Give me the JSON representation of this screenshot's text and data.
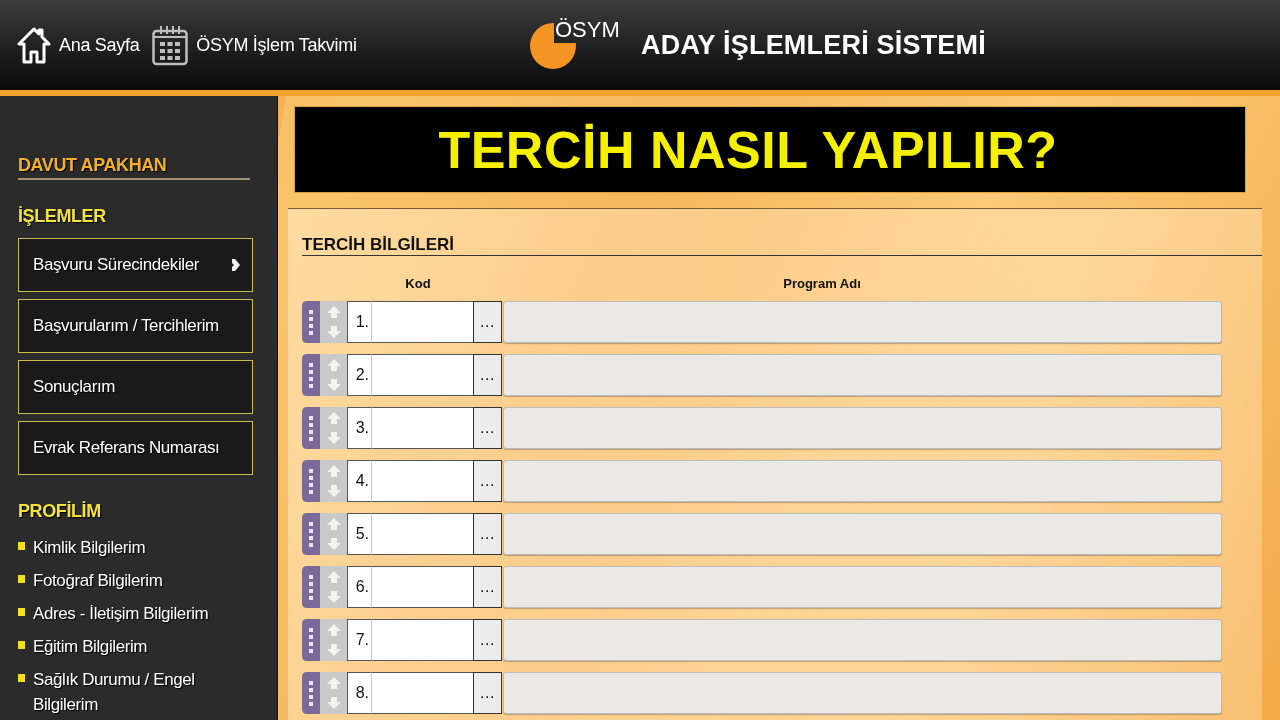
{
  "header": {
    "nav": [
      {
        "kind": "home",
        "label": "Ana Sayfa"
      },
      {
        "kind": "calendar",
        "label": "ÖSYM İşlem Takvimi"
      }
    ],
    "logo_text": "ÖSYM",
    "title": "ADAY İŞLEMLERİ SİSTEMİ"
  },
  "sidebar": {
    "user_name": "DAVUT APAKHAN",
    "sections": [
      {
        "kind": "buttons",
        "heading": "İŞLEMLER",
        "items": [
          {
            "label": "Başvuru Sürecindekiler",
            "has_submenu": true
          },
          {
            "label": "Başvurularım / Tercihlerim",
            "has_submenu": false
          },
          {
            "label": "Sonuçlarım",
            "has_submenu": false
          },
          {
            "label": "Evrak Referans Numarası",
            "has_submenu": false
          }
        ]
      },
      {
        "kind": "links",
        "heading": "PROFİLİM",
        "items": [
          {
            "label": "Kimlik Bilgilerim"
          },
          {
            "label": "Fotoğraf Bilgilerim"
          },
          {
            "label": "Adres - İletişim Bilgilerim"
          },
          {
            "label": "Eğitim Bilgilerim"
          },
          {
            "label": "Sağlık Durumu / Engel Bilgilerim"
          }
        ]
      }
    ]
  },
  "banner": {
    "title": "TERCİH NASIL YAPILIR?"
  },
  "preferences": {
    "title": "TERCİH BİLGİLERİ",
    "columns": [
      "Kod",
      "Program Adı"
    ],
    "rows": [
      {
        "number": "1.",
        "lookup_label": "..."
      },
      {
        "number": "2.",
        "lookup_label": "..."
      },
      {
        "number": "3.",
        "lookup_label": "..."
      },
      {
        "number": "4.",
        "lookup_label": "..."
      },
      {
        "number": "5.",
        "lookup_label": "..."
      },
      {
        "number": "6.",
        "lookup_label": "..."
      },
      {
        "number": "7.",
        "lookup_label": "..."
      },
      {
        "number": "8.",
        "lookup_label": "..."
      }
    ]
  }
}
